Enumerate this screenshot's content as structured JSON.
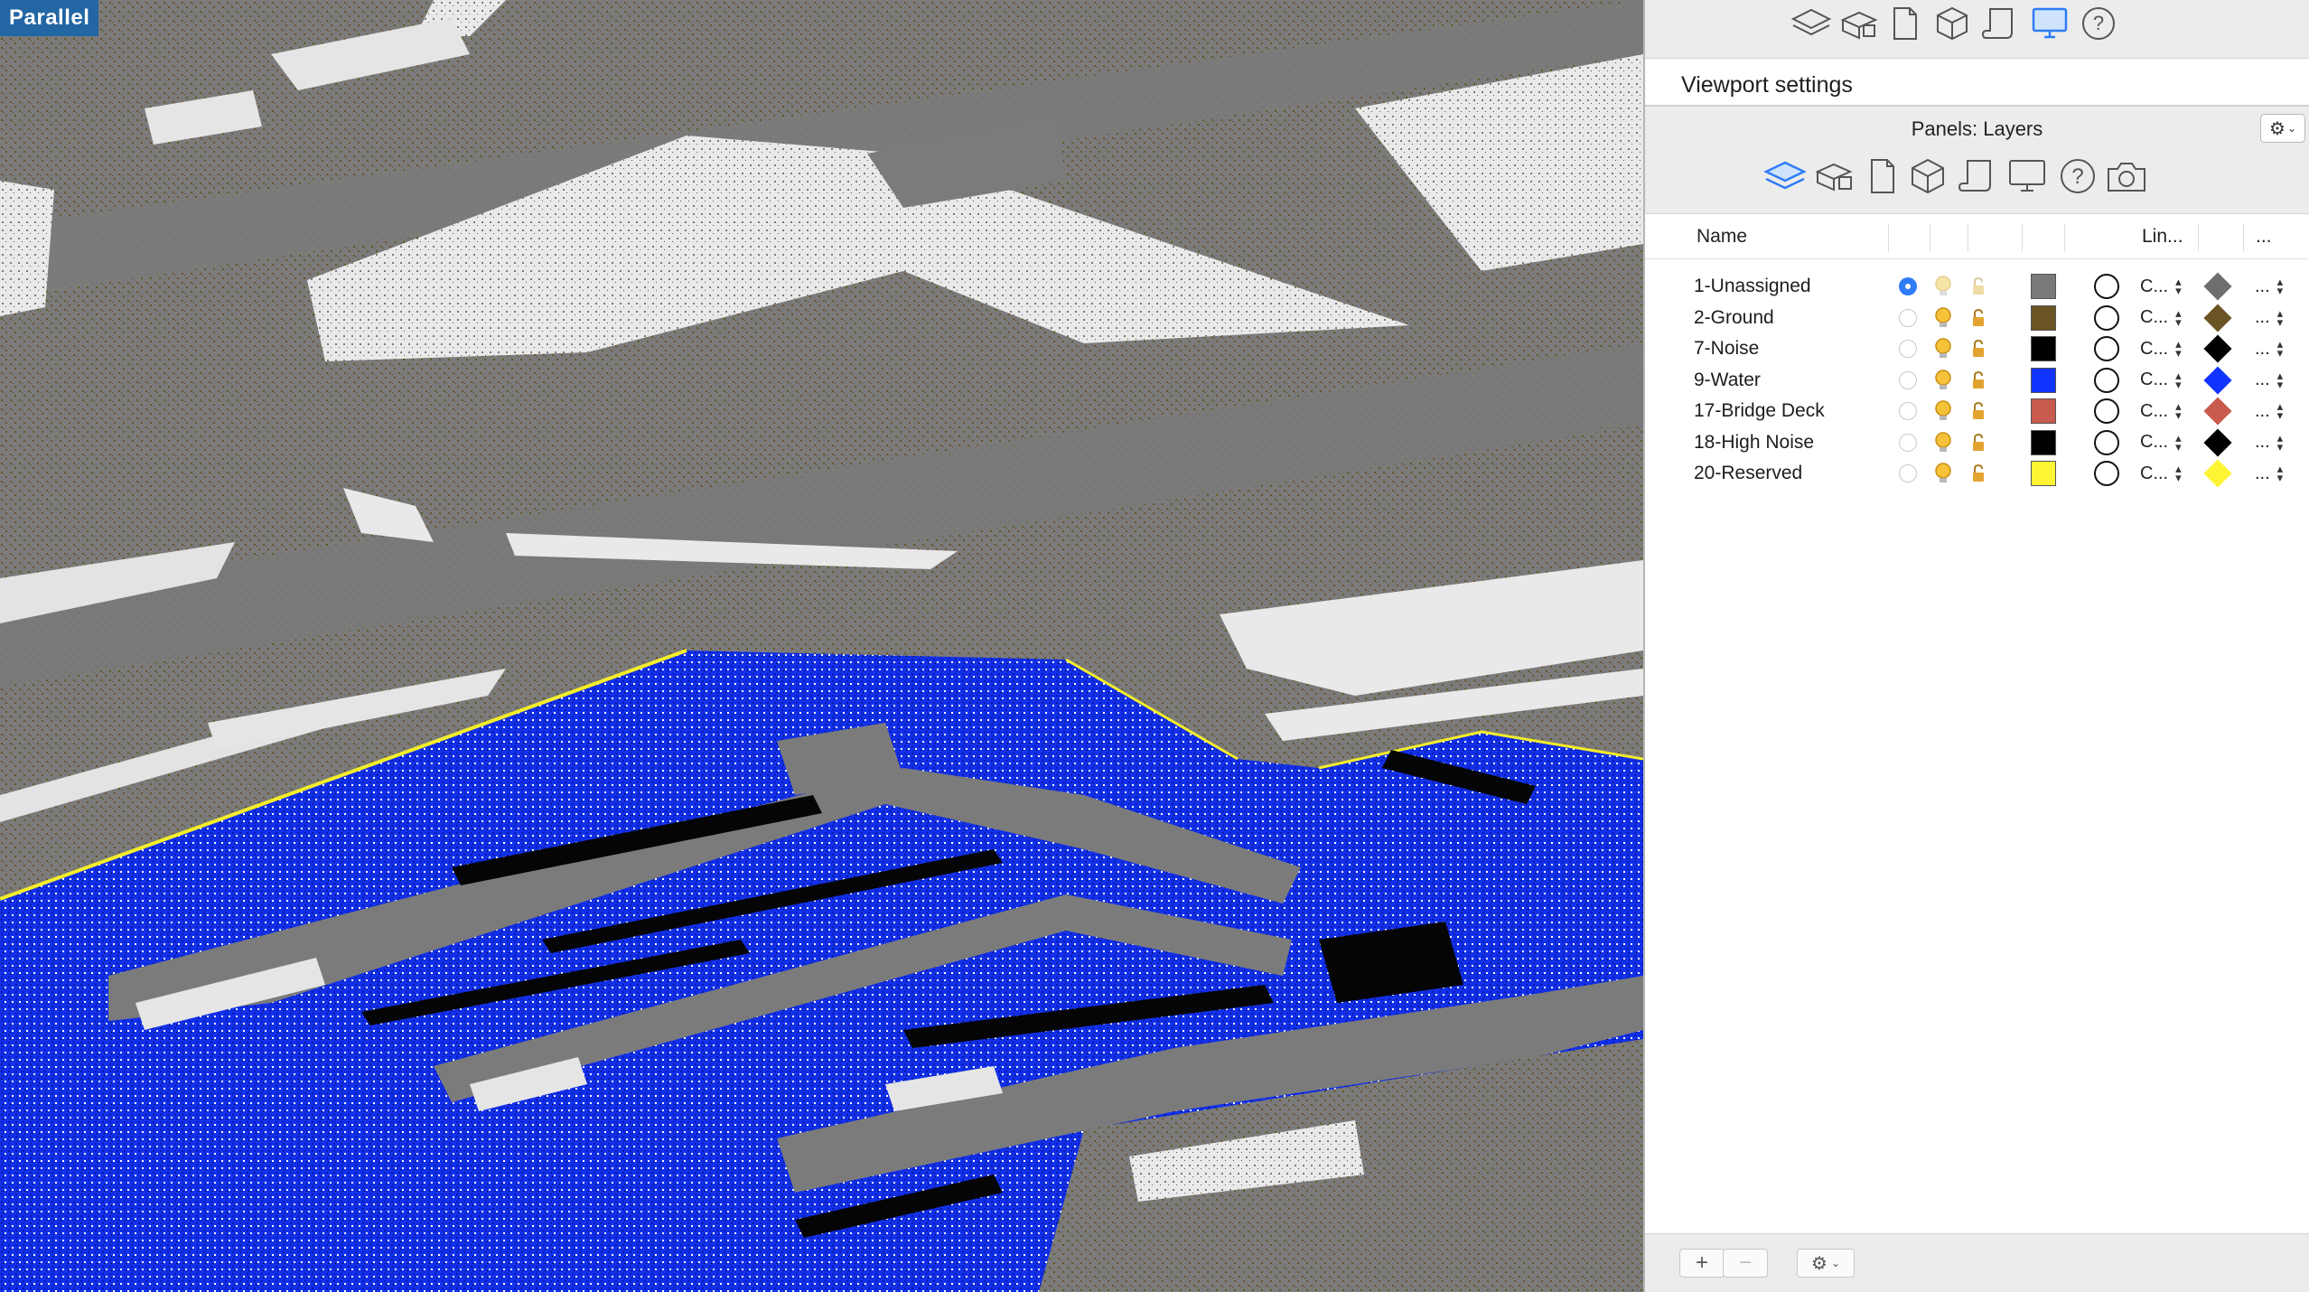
{
  "viewport": {
    "projection_label": "Parallel"
  },
  "panel": {
    "toolbar_icons": [
      "layers-icon",
      "classes-icon",
      "sheet-icon",
      "object-icon",
      "scroll-icon",
      "display-icon",
      "help-icon"
    ],
    "section_title": "Viewport settings",
    "panels_title": "Panels: Layers",
    "gear_menu_label": "⚙",
    "sub_toolbar_icons": [
      "layers-icon",
      "classes-icon",
      "sheet-icon",
      "object-icon",
      "scroll-icon",
      "display-icon",
      "help-icon",
      "camera-icon"
    ],
    "columns": {
      "name": "Name",
      "line": "Lin...",
      "more": "..."
    },
    "layers": [
      {
        "name": "1-Unassigned",
        "active": true,
        "color": "#7a7a7a",
        "line_type": "C...",
        "marker_color": "#6e6e6e",
        "more": "..."
      },
      {
        "name": "2-Ground",
        "active": false,
        "color": "#6b5423",
        "line_type": "C...",
        "marker_color": "#6b5423",
        "more": "..."
      },
      {
        "name": "7-Noise",
        "active": false,
        "color": "#000000",
        "line_type": "C...",
        "marker_color": "#000000",
        "more": "..."
      },
      {
        "name": "9-Water",
        "active": false,
        "color": "#1133ff",
        "line_type": "C...",
        "marker_color": "#1133ff",
        "more": "..."
      },
      {
        "name": "17-Bridge Deck",
        "active": false,
        "color": "#c85a4e",
        "line_type": "C...",
        "marker_color": "#c85a4e",
        "more": "..."
      },
      {
        "name": "18-High Noise",
        "active": false,
        "color": "#000000",
        "line_type": "C...",
        "marker_color": "#000000",
        "more": "..."
      },
      {
        "name": "20-Reserved",
        "active": false,
        "color": "#fff433",
        "line_type": "C...",
        "marker_color": "#fff433",
        "more": "..."
      }
    ],
    "footer": {
      "add_label": "+",
      "remove_label": "−",
      "gear_label": "⚙"
    }
  },
  "colors": {
    "selection_blue": "#2f7cf6",
    "badge_blue": "#2266a4",
    "ground_brown": "#6b5423",
    "water_blue": "#1133ff",
    "structure_gray": "#7b7b7b",
    "highlight_white": "#e8e8e8"
  }
}
